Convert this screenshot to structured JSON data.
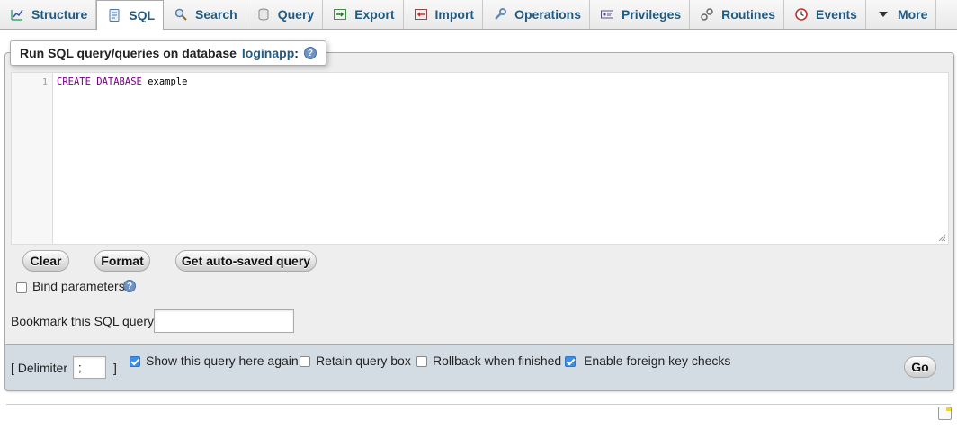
{
  "tabs": [
    {
      "label": "Structure",
      "icon": "structure-icon"
    },
    {
      "label": "SQL",
      "icon": "sql-icon",
      "active": true
    },
    {
      "label": "Search",
      "icon": "search-icon"
    },
    {
      "label": "Query",
      "icon": "query-icon"
    },
    {
      "label": "Export",
      "icon": "export-icon"
    },
    {
      "label": "Import",
      "icon": "import-icon"
    },
    {
      "label": "Operations",
      "icon": "wrench-icon"
    },
    {
      "label": "Privileges",
      "icon": "privileges-icon"
    },
    {
      "label": "Routines",
      "icon": "routines-icon"
    },
    {
      "label": "Events",
      "icon": "clock-icon"
    },
    {
      "label": "More",
      "icon": "triangle-down-icon"
    }
  ],
  "panel": {
    "legend_prefix": "Run SQL query/queries on database",
    "database": "loginapp",
    "legend_suffix": ":",
    "help_glyph": "?"
  },
  "editor": {
    "line_number": "1",
    "kw1": "CREATE",
    "kw2": "DATABASE",
    "rest": "example"
  },
  "buttons": {
    "clear": "Clear",
    "format": "Format",
    "autosaved": "Get auto-saved query",
    "go": "Go"
  },
  "bind_parameters": {
    "label": "Bind parameters",
    "checked": false
  },
  "bookmark": {
    "label": "Bookmark this SQL query:",
    "value": ""
  },
  "options": {
    "delimiter_label_open": "[ Delimiter",
    "delimiter_value": ";",
    "delimiter_label_close": "]",
    "show_again": {
      "label": "Show this query here again",
      "checked": true
    },
    "retain_box": {
      "label": "Retain query box",
      "checked": false
    },
    "rollback": {
      "label": "Rollback when finished",
      "checked": false
    },
    "foreign_keys": {
      "label": "Enable foreign key checks",
      "checked": true
    }
  },
  "colors": {
    "link_blue": "#235a81",
    "footer_bg": "#d3dce3",
    "panel_bg": "#eeeeee",
    "checkbox_blue": "#3d8ee6"
  }
}
